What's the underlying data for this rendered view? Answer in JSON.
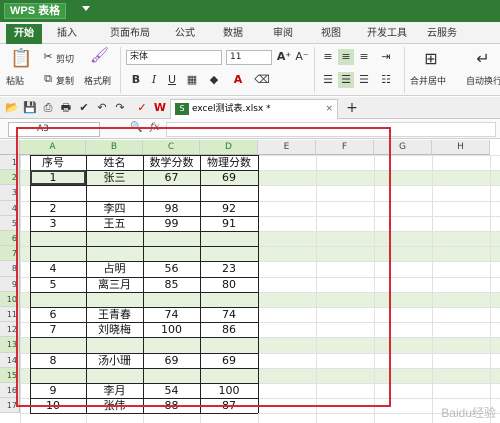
{
  "app": {
    "title": "WPS 表格"
  },
  "ribbon_tabs": [
    "开始",
    "插入",
    "页面布局",
    "公式",
    "数据",
    "审阅",
    "视图",
    "开发工具",
    "云服务"
  ],
  "ribbon": {
    "cut": "剪切",
    "paste": "粘贴",
    "copy": "复制",
    "format_painter": "格式刷",
    "font_name": "宋体",
    "font_size": "11",
    "merge_center": "合并居中",
    "auto_wrap": "自动换行"
  },
  "document_tab": "excel测试表.xlsx *",
  "formula_bar": {
    "name_box": "A3",
    "fx": "fx"
  },
  "columns": [
    "A",
    "B",
    "C",
    "D",
    "E",
    "F",
    "G",
    "H"
  ],
  "row_numbers": [
    "1",
    "2",
    "3",
    "4",
    "5",
    "6",
    "7",
    "8",
    "9",
    "10",
    "11",
    "12",
    "13",
    "14",
    "15",
    "16",
    "17"
  ],
  "table": {
    "headers": [
      "序号",
      "姓名",
      "数学分数",
      "物理分数"
    ],
    "rows": [
      [
        "1",
        "张三",
        "67",
        "69"
      ],
      [
        "",
        "",
        "",
        ""
      ],
      [
        "2",
        "李四",
        "98",
        "92"
      ],
      [
        "3",
        "王五",
        "99",
        "91"
      ],
      [
        "",
        "",
        "",
        ""
      ],
      [
        "",
        "",
        "",
        ""
      ],
      [
        "4",
        "占明",
        "56",
        "23"
      ],
      [
        "5",
        "离三月",
        "85",
        "80"
      ],
      [
        "",
        "",
        "",
        ""
      ],
      [
        "6",
        "王青春",
        "74",
        "74"
      ],
      [
        "7",
        "刘晓梅",
        "100",
        "86"
      ],
      [
        "",
        "",
        "",
        ""
      ],
      [
        "8",
        "汤小珊",
        "69",
        "69"
      ],
      [
        "",
        "",
        "",
        ""
      ],
      [
        "9",
        "李月",
        "54",
        "100"
      ],
      [
        "10",
        "张伟",
        "88",
        "87"
      ]
    ]
  },
  "colors": {
    "accent": "#2f7a34",
    "highlight": "#e6f2de",
    "annotation": "#d42a36"
  },
  "watermark": "Baidu经验"
}
